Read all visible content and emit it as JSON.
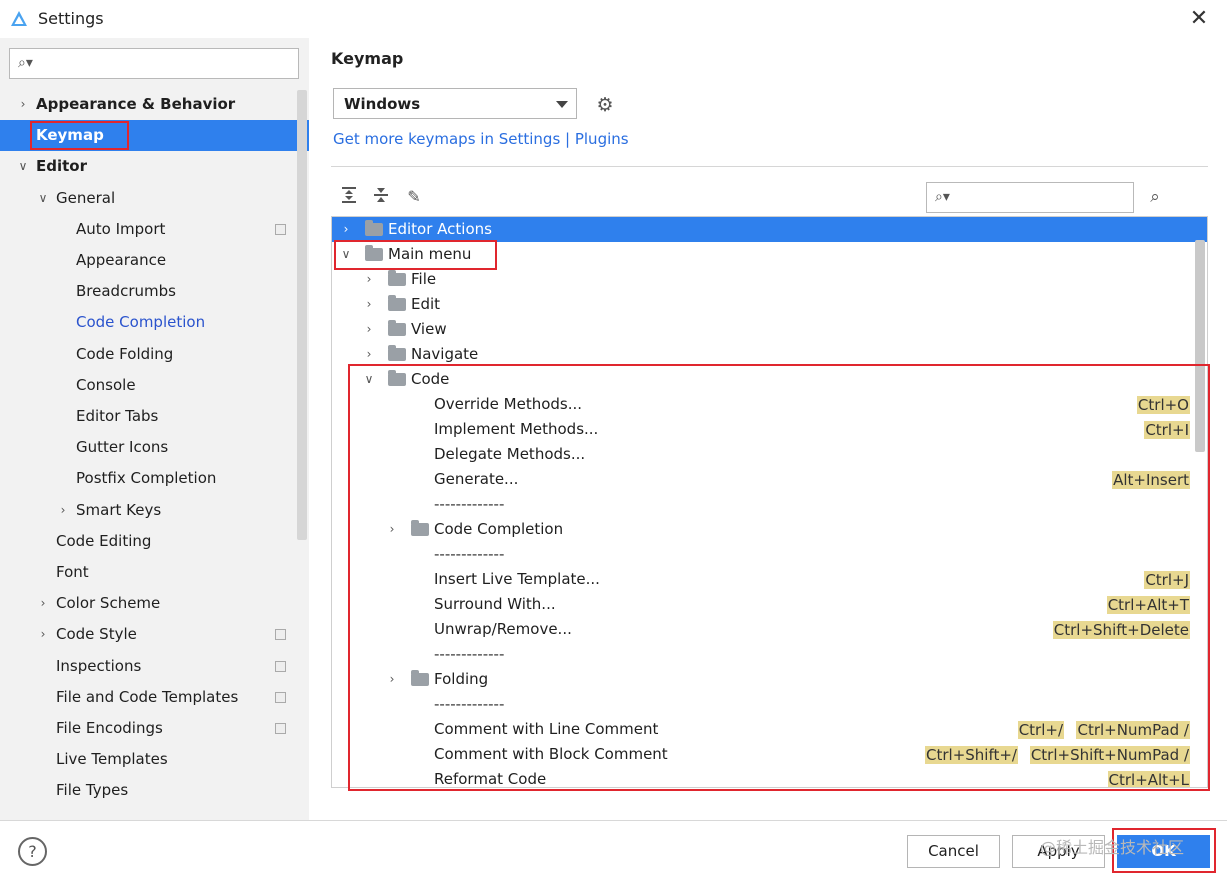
{
  "window": {
    "title": "Settings",
    "close_glyph": "✕"
  },
  "sidebar": {
    "search": {
      "placeholder": ""
    },
    "items": [
      {
        "label": "Appearance & Behavior",
        "chev": ">",
        "bold": true
      },
      {
        "label": "Keymap",
        "selected": true
      },
      {
        "label": "Editor",
        "chev": "v",
        "bold": true
      },
      {
        "label": "General",
        "chev": "v"
      },
      {
        "label": "Auto Import",
        "copy": true
      },
      {
        "label": "Appearance"
      },
      {
        "label": "Breadcrumbs"
      },
      {
        "label": "Code Completion",
        "link": true
      },
      {
        "label": "Code Folding"
      },
      {
        "label": "Console"
      },
      {
        "label": "Editor Tabs"
      },
      {
        "label": "Gutter Icons"
      },
      {
        "label": "Postfix Completion"
      },
      {
        "label": "Smart Keys",
        "chev": ">"
      },
      {
        "label": "Code Editing"
      },
      {
        "label": "Font"
      },
      {
        "label": "Color Scheme",
        "chev": ">"
      },
      {
        "label": "Code Style",
        "chev": ">",
        "copy": true
      },
      {
        "label": "Inspections",
        "copy": true
      },
      {
        "label": "File and Code Templates",
        "copy": true
      },
      {
        "label": "File Encodings",
        "copy": true
      },
      {
        "label": "Live Templates"
      },
      {
        "label": "File Types"
      }
    ]
  },
  "main": {
    "heading": "Keymap",
    "keymap_select": {
      "value": "Windows"
    },
    "plugins_link": "Get more keymaps in Settings | Plugins",
    "search": {
      "placeholder": ""
    },
    "tree": [
      {
        "label": "Editor Actions",
        "chev": ">",
        "folder": true,
        "selected": true
      },
      {
        "label": "Main menu",
        "chev": "v",
        "folder": true
      },
      {
        "label": "File",
        "chev": ">",
        "folder": true
      },
      {
        "label": "Edit",
        "chev": ">",
        "folder": true
      },
      {
        "label": "View",
        "chev": ">",
        "folder": true
      },
      {
        "label": "Navigate",
        "chev": ">",
        "folder": true
      },
      {
        "label": "Code",
        "chev": "v",
        "folder": true
      },
      {
        "label": "Override Methods...",
        "shortcuts": [
          "Ctrl+O"
        ]
      },
      {
        "label": "Implement Methods...",
        "shortcuts": [
          "Ctrl+I"
        ]
      },
      {
        "label": "Delegate Methods..."
      },
      {
        "label": "Generate...",
        "shortcuts": [
          "Alt+Insert"
        ]
      },
      {
        "label": "-------------",
        "separator": true
      },
      {
        "label": "Code Completion",
        "chev": ">",
        "folder": true
      },
      {
        "label": "-------------",
        "separator": true
      },
      {
        "label": "Insert Live Template...",
        "shortcuts": [
          "Ctrl+J"
        ]
      },
      {
        "label": "Surround With...",
        "shortcuts": [
          "Ctrl+Alt+T"
        ]
      },
      {
        "label": "Unwrap/Remove...",
        "shortcuts": [
          "Ctrl+Shift+Delete"
        ]
      },
      {
        "label": "-------------",
        "separator": true
      },
      {
        "label": "Folding",
        "chev": ">",
        "folder": true
      },
      {
        "label": "-------------",
        "separator": true
      },
      {
        "label": "Comment with Line Comment",
        "shortcuts": [
          "Ctrl+/",
          "Ctrl+NumPad /"
        ]
      },
      {
        "label": "Comment with Block Comment",
        "shortcuts": [
          "Ctrl+Shift+/",
          "Ctrl+Shift+NumPad /"
        ]
      },
      {
        "label": "Reformat Code",
        "shortcuts": [
          "Ctrl+Alt+L"
        ]
      }
    ]
  },
  "footer": {
    "help": "?",
    "cancel_label": "Cancel",
    "apply_label": "Apply",
    "ok_label": "OK",
    "watermark": "@稀土掘金技术社区"
  },
  "colors": {
    "accent": "#2f80ed",
    "shortcut_bg": "#e8d891",
    "highlight_box": "#e0262e",
    "link": "#2a6ee0"
  },
  "icons": [
    "android-studio-icon",
    "search-icon",
    "gear-icon",
    "expand-all-icon",
    "collapse-all-icon",
    "edit-icon",
    "find-shortcut-icon",
    "folder-icon",
    "help-icon",
    "copy-icon"
  ]
}
